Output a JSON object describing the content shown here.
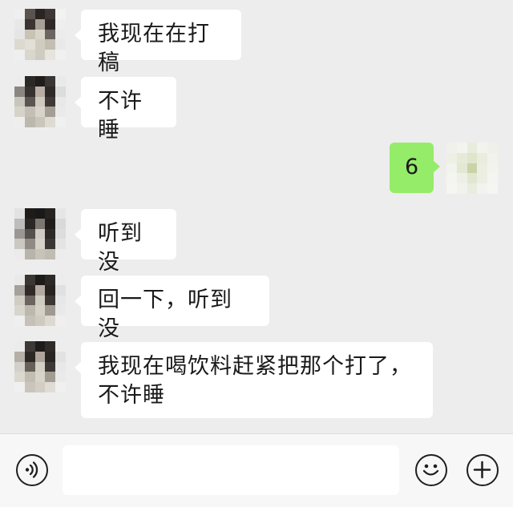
{
  "messages": [
    {
      "side": "left",
      "text": "我现在在打稿"
    },
    {
      "side": "left",
      "text": "不许睡"
    },
    {
      "side": "right",
      "text": "6"
    },
    {
      "side": "left",
      "text": "听到没"
    },
    {
      "side": "left",
      "text": "回一下，听到没"
    },
    {
      "side": "left",
      "text": "我现在喝饮料赶紧把那个打了，不许睡"
    }
  ],
  "input": {
    "value": "",
    "placeholder": ""
  },
  "icons": {
    "voice": "voice-input-icon",
    "emoji": "emoji-icon",
    "more": "plus-icon"
  },
  "colors": {
    "background": "#ededed",
    "own_bubble": "#95ec69",
    "other_bubble": "#ffffff"
  }
}
